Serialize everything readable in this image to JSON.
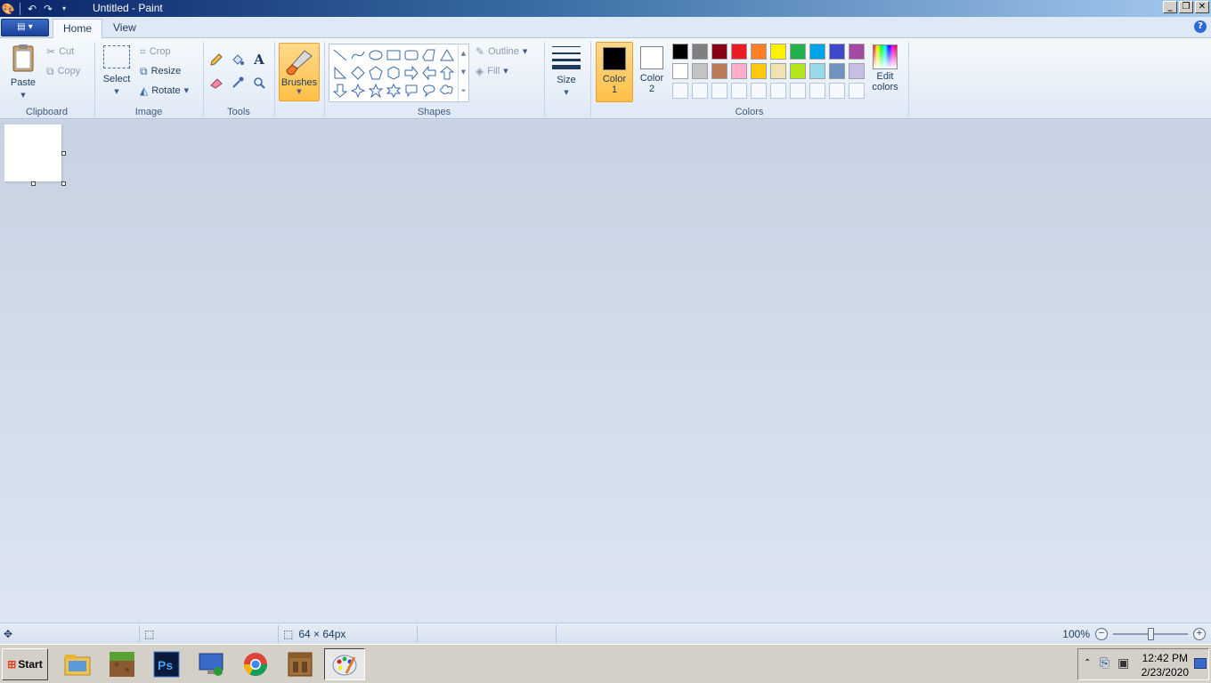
{
  "window": {
    "title": "Untitled - Paint",
    "qat_items": [
      "undo-icon",
      "redo-icon",
      "customize-qat-icon"
    ]
  },
  "tabs": [
    {
      "label": "Home",
      "active": true
    },
    {
      "label": "View",
      "active": false
    }
  ],
  "help_label": "?",
  "ribbon": {
    "clipboard": {
      "group_label": "Clipboard",
      "paste": "Paste",
      "cut": "Cut",
      "copy": "Copy"
    },
    "image": {
      "group_label": "Image",
      "select": "Select",
      "crop": "Crop",
      "resize": "Resize",
      "rotate": "Rotate"
    },
    "tools": {
      "group_label": "Tools",
      "items": [
        "pencil-icon",
        "fill-icon",
        "text-icon",
        "eraser-icon",
        "color-picker-icon",
        "magnifier-icon"
      ]
    },
    "brushes": {
      "label": "Brushes"
    },
    "shapes": {
      "group_label": "Shapes",
      "outline": "Outline",
      "fill": "Fill"
    },
    "size": {
      "label": "Size"
    },
    "colors": {
      "group_label": "Colors",
      "color1": {
        "label_line1": "Color",
        "label_line2": "1",
        "value": "#000000"
      },
      "color2": {
        "label_line1": "Color",
        "label_line2": "2",
        "value": "#ffffff"
      },
      "edit_line1": "Edit",
      "edit_line2": "colors",
      "palette": [
        "#000000",
        "#7f7f7f",
        "#880015",
        "#ed1c24",
        "#ff7f27",
        "#fff200",
        "#22b14c",
        "#00a2e8",
        "#3f48cc",
        "#a349a4",
        "#ffffff",
        "#c3c3c3",
        "#b97a57",
        "#ffaec9",
        "#ffc90e",
        "#efe4b0",
        "#b5e61d",
        "#99d9ea",
        "#7092be",
        "#c8bfe7",
        "",
        "",
        "",
        "",
        "",
        "",
        "",
        "",
        "",
        ""
      ]
    }
  },
  "status": {
    "canvas_size": "64 × 64px",
    "zoom": "100%",
    "zoom_level": 1.0
  },
  "taskbar": {
    "start_label": "Start",
    "apps": [
      "file-explorer-icon",
      "minecraft-icon",
      "photoshop-icon",
      "remote-desktop-icon",
      "chrome-icon",
      "crafting-table-icon",
      "paint-icon"
    ],
    "clock_time": "12:42 PM",
    "clock_date": "2/23/2020"
  }
}
